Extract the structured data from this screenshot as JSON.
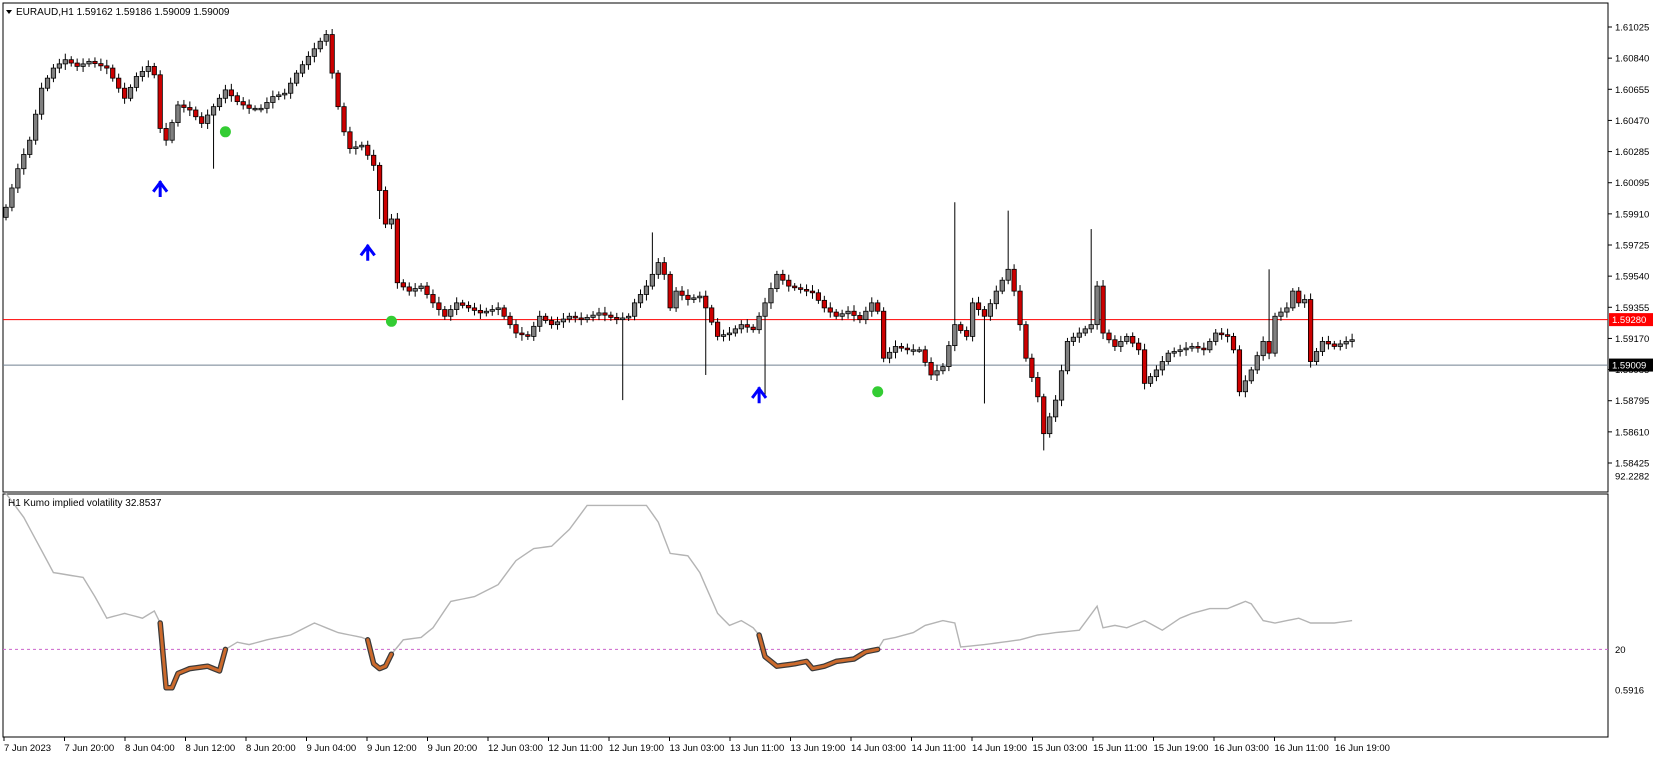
{
  "main_panel": {
    "header": "EURAUD,H1  1.59162 1.59186 1.59009 1.59009",
    "price_axis": [
      "1.61025",
      "1.60840",
      "1.60655",
      "1.60470",
      "1.60285",
      "1.60095",
      "1.59910",
      "1.59725",
      "1.59540",
      "1.59355",
      "1.59170",
      "1.58985",
      "1.58795",
      "1.58610",
      "1.58425"
    ],
    "red_line_label": "1.59280",
    "current_price_label": "1.59009",
    "colors": {
      "bull_body": "#808080",
      "bear_body": "#cc0000",
      "wick": "#000000",
      "red_line": "#ff0000",
      "price_line": "#708090",
      "arrow": "#0000ff",
      "dot": "#33cc33"
    }
  },
  "indicator_panel": {
    "header": "H1 Kumo implied volatility 32.8537",
    "axis_labels": [
      "92.2282",
      "20",
      "0.5916"
    ],
    "colors": {
      "line": "#b4b4b4",
      "highlight": "#cc6a2c",
      "level": "#cc66cc"
    }
  },
  "time_axis": [
    "7 Jun 2023",
    "7 Jun 20:00",
    "8 Jun 04:00",
    "8 Jun 12:00",
    "8 Jun 20:00",
    "9 Jun 04:00",
    "9 Jun 12:00",
    "9 Jun 20:00",
    "12 Jun 03:00",
    "12 Jun 11:00",
    "12 Jun 19:00",
    "13 Jun 03:00",
    "13 Jun 11:00",
    "13 Jun 19:00",
    "14 Jun 03:00",
    "14 Jun 11:00",
    "14 Jun 19:00",
    "15 Jun 03:00",
    "15 Jun 11:00",
    "15 Jun 19:00",
    "16 Jun 03:00",
    "16 Jun 11:00",
    "16 Jun 19:00"
  ],
  "chart_data": {
    "type": "candlestick",
    "symbol": "EURAUD",
    "timeframe": "H1",
    "last_bar": {
      "open": 1.59162,
      "high": 1.59186,
      "low": 1.59009,
      "close": 1.59009
    },
    "ylim": [
      1.58425,
      1.61025
    ],
    "red_level": 1.5928,
    "current_price": 1.59009,
    "anchors": [
      {
        "i": 0,
        "p": 1.5995
      },
      {
        "i": 2,
        "p": 1.6018
      },
      {
        "i": 4,
        "p": 1.6035
      },
      {
        "i": 6,
        "p": 1.6066
      },
      {
        "i": 8,
        "p": 1.6078
      },
      {
        "i": 10,
        "p": 1.6083
      },
      {
        "i": 12,
        "p": 1.6079
      },
      {
        "i": 14,
        "p": 1.6082
      },
      {
        "i": 17,
        "p": 1.6078
      },
      {
        "i": 20,
        "p": 1.606
      },
      {
        "i": 22,
        "p": 1.6073
      },
      {
        "i": 24,
        "p": 1.6079
      },
      {
        "i": 25,
        "p": 1.6074
      },
      {
        "i": 26,
        "p": 1.6042
      },
      {
        "i": 27,
        "p": 1.6035
      },
      {
        "i": 29,
        "p": 1.6056
      },
      {
        "i": 31,
        "p": 1.6053
      },
      {
        "i": 33,
        "p": 1.6045
      },
      {
        "i": 35,
        "p": 1.6055
      },
      {
        "i": 37,
        "p": 1.6065
      },
      {
        "i": 39,
        "p": 1.6058
      },
      {
        "i": 41,
        "p": 1.6054
      },
      {
        "i": 43,
        "p": 1.6054
      },
      {
        "i": 45,
        "p": 1.6061
      },
      {
        "i": 47,
        "p": 1.6063
      },
      {
        "i": 49,
        "p": 1.6075
      },
      {
        "i": 51,
        "p": 1.6085
      },
      {
        "i": 53,
        "p": 1.6094
      },
      {
        "i": 54,
        "p": 1.6098
      },
      {
        "i": 55,
        "p": 1.6075
      },
      {
        "i": 56,
        "p": 1.6055
      },
      {
        "i": 57,
        "p": 1.604
      },
      {
        "i": 58,
        "p": 1.603
      },
      {
        "i": 60,
        "p": 1.6032
      },
      {
        "i": 62,
        "p": 1.602
      },
      {
        "i": 63,
        "p": 1.6005
      },
      {
        "i": 64,
        "p": 1.5985
      },
      {
        "i": 65,
        "p": 1.5988
      },
      {
        "i": 66,
        "p": 1.595
      },
      {
        "i": 68,
        "p": 1.5945
      },
      {
        "i": 70,
        "p": 1.5948
      },
      {
        "i": 72,
        "p": 1.5938
      },
      {
        "i": 74,
        "p": 1.593
      },
      {
        "i": 76,
        "p": 1.5938
      },
      {
        "i": 78,
        "p": 1.5935
      },
      {
        "i": 80,
        "p": 1.5932
      },
      {
        "i": 83,
        "p": 1.5935
      },
      {
        "i": 86,
        "p": 1.592
      },
      {
        "i": 88,
        "p": 1.5918
      },
      {
        "i": 90,
        "p": 1.593
      },
      {
        "i": 92,
        "p": 1.5925
      },
      {
        "i": 95,
        "p": 1.593
      },
      {
        "i": 97,
        "p": 1.5928
      },
      {
        "i": 100,
        "p": 1.5932
      },
      {
        "i": 103,
        "p": 1.5928
      },
      {
        "i": 105,
        "p": 1.593
      },
      {
        "i": 106,
        "p": 1.5938
      },
      {
        "i": 108,
        "p": 1.5948
      },
      {
        "i": 110,
        "p": 1.5962
      },
      {
        "i": 111,
        "p": 1.5955
      },
      {
        "i": 112,
        "p": 1.5935
      },
      {
        "i": 113,
        "p": 1.5945
      },
      {
        "i": 115,
        "p": 1.594
      },
      {
        "i": 117,
        "p": 1.5942
      },
      {
        "i": 118,
        "p": 1.5935
      },
      {
        "i": 120,
        "p": 1.5918
      },
      {
        "i": 122,
        "p": 1.592
      },
      {
        "i": 124,
        "p": 1.5925
      },
      {
        "i": 126,
        "p": 1.5922
      },
      {
        "i": 128,
        "p": 1.5938
      },
      {
        "i": 130,
        "p": 1.5955
      },
      {
        "i": 132,
        "p": 1.5948
      },
      {
        "i": 134,
        "p": 1.5946
      },
      {
        "i": 136,
        "p": 1.5944
      },
      {
        "i": 138,
        "p": 1.5935
      },
      {
        "i": 140,
        "p": 1.593
      },
      {
        "i": 142,
        "p": 1.5933
      },
      {
        "i": 144,
        "p": 1.5928
      },
      {
        "i": 146,
        "p": 1.5938
      },
      {
        "i": 147,
        "p": 1.5933
      },
      {
        "i": 148,
        "p": 1.5905
      },
      {
        "i": 150,
        "p": 1.5912
      },
      {
        "i": 152,
        "p": 1.591
      },
      {
        "i": 154,
        "p": 1.591
      },
      {
        "i": 156,
        "p": 1.5895
      },
      {
        "i": 158,
        "p": 1.59
      },
      {
        "i": 160,
        "p": 1.5925
      },
      {
        "i": 162,
        "p": 1.5918
      },
      {
        "i": 163,
        "p": 1.5938
      },
      {
        "i": 165,
        "p": 1.593
      },
      {
        "i": 167,
        "p": 1.5945
      },
      {
        "i": 169,
        "p": 1.5958
      },
      {
        "i": 170,
        "p": 1.5945
      },
      {
        "i": 172,
        "p": 1.5905
      },
      {
        "i": 174,
        "p": 1.5882
      },
      {
        "i": 175,
        "p": 1.586
      },
      {
        "i": 177,
        "p": 1.588
      },
      {
        "i": 179,
        "p": 1.5915
      },
      {
        "i": 181,
        "p": 1.592
      },
      {
        "i": 183,
        "p": 1.5925
      },
      {
        "i": 184,
        "p": 1.5948
      },
      {
        "i": 185,
        "p": 1.592
      },
      {
        "i": 187,
        "p": 1.5912
      },
      {
        "i": 189,
        "p": 1.5918
      },
      {
        "i": 191,
        "p": 1.591
      },
      {
        "i": 192,
        "p": 1.589
      },
      {
        "i": 194,
        "p": 1.5898
      },
      {
        "i": 196,
        "p": 1.5908
      },
      {
        "i": 198,
        "p": 1.591
      },
      {
        "i": 200,
        "p": 1.5912
      },
      {
        "i": 202,
        "p": 1.591
      },
      {
        "i": 204,
        "p": 1.592
      },
      {
        "i": 206,
        "p": 1.5918
      },
      {
        "i": 207,
        "p": 1.591
      },
      {
        "i": 208,
        "p": 1.5885
      },
      {
        "i": 210,
        "p": 1.5898
      },
      {
        "i": 212,
        "p": 1.5915
      },
      {
        "i": 213,
        "p": 1.5908
      },
      {
        "i": 214,
        "p": 1.593
      },
      {
        "i": 216,
        "p": 1.5935
      },
      {
        "i": 217,
        "p": 1.5945
      },
      {
        "i": 218,
        "p": 1.5938
      },
      {
        "i": 219,
        "p": 1.594
      },
      {
        "i": 220,
        "p": 1.5903
      },
      {
        "i": 222,
        "p": 1.5915
      },
      {
        "i": 224,
        "p": 1.5912
      },
      {
        "i": 226,
        "p": 1.5915
      },
      {
        "i": 227,
        "p": 1.5916
      }
    ],
    "spikes": [
      {
        "i": 35,
        "low": 1.6018
      },
      {
        "i": 63,
        "low": 1.5988
      },
      {
        "i": 109,
        "high": 1.598
      },
      {
        "i": 118,
        "low": 1.5895
      },
      {
        "i": 104,
        "low": 1.588
      },
      {
        "i": 128,
        "low": 1.5883
      },
      {
        "i": 160,
        "high": 1.5998
      },
      {
        "i": 165,
        "low": 1.5878
      },
      {
        "i": 169,
        "high": 1.5993
      },
      {
        "i": 183,
        "high": 1.5982
      },
      {
        "i": 213,
        "high": 1.5958
      },
      {
        "i": 175,
        "low": 1.585
      }
    ],
    "buy_arrows": [
      {
        "i": 26,
        "price": 1.6008
      },
      {
        "i": 61,
        "price": 1.597
      },
      {
        "i": 127,
        "price": 1.5885
      }
    ],
    "dots": [
      {
        "i": 37,
        "price": 1.604
      },
      {
        "i": 65,
        "price": 1.5927
      },
      {
        "i": 147,
        "price": 1.5885
      }
    ],
    "indicator": {
      "name": "Kumo implied volatility",
      "value": 32.8537,
      "ylim": [
        0.5916,
        92.2282
      ],
      "level": 20,
      "line": [
        {
          "i": 0,
          "v": 85
        },
        {
          "i": 3,
          "v": 75
        },
        {
          "i": 8,
          "v": 52
        },
        {
          "i": 13,
          "v": 50
        },
        {
          "i": 15,
          "v": 42
        },
        {
          "i": 17,
          "v": 33
        },
        {
          "i": 20,
          "v": 35
        },
        {
          "i": 23,
          "v": 33
        },
        {
          "i": 25,
          "v": 36
        },
        {
          "i": 26,
          "v": 31
        },
        {
          "i": 27,
          "v": 4
        },
        {
          "i": 28,
          "v": 4
        },
        {
          "i": 29,
          "v": 10
        },
        {
          "i": 31,
          "v": 12
        },
        {
          "i": 34,
          "v": 13
        },
        {
          "i": 36,
          "v": 11
        },
        {
          "i": 37,
          "v": 20
        },
        {
          "i": 39,
          "v": 23
        },
        {
          "i": 41,
          "v": 22
        },
        {
          "i": 44,
          "v": 24
        },
        {
          "i": 48,
          "v": 26
        },
        {
          "i": 52,
          "v": 31
        },
        {
          "i": 56,
          "v": 27
        },
        {
          "i": 60,
          "v": 25
        },
        {
          "i": 61,
          "v": 24
        },
        {
          "i": 62,
          "v": 14
        },
        {
          "i": 63,
          "v": 12
        },
        {
          "i": 64,
          "v": 13
        },
        {
          "i": 65,
          "v": 18
        },
        {
          "i": 67,
          "v": 24
        },
        {
          "i": 70,
          "v": 25
        },
        {
          "i": 72,
          "v": 29
        },
        {
          "i": 75,
          "v": 40
        },
        {
          "i": 79,
          "v": 42
        },
        {
          "i": 83,
          "v": 47
        },
        {
          "i": 86,
          "v": 57
        },
        {
          "i": 89,
          "v": 62
        },
        {
          "i": 92,
          "v": 63
        },
        {
          "i": 95,
          "v": 70
        },
        {
          "i": 98,
          "v": 80
        },
        {
          "i": 101,
          "v": 80
        },
        {
          "i": 105,
          "v": 80
        },
        {
          "i": 108,
          "v": 80
        },
        {
          "i": 110,
          "v": 73
        },
        {
          "i": 112,
          "v": 60
        },
        {
          "i": 115,
          "v": 59
        },
        {
          "i": 117,
          "v": 52
        },
        {
          "i": 120,
          "v": 35
        },
        {
          "i": 122,
          "v": 30
        },
        {
          "i": 124,
          "v": 32
        },
        {
          "i": 126,
          "v": 29
        },
        {
          "i": 127,
          "v": 26
        },
        {
          "i": 128,
          "v": 17
        },
        {
          "i": 130,
          "v": 13
        },
        {
          "i": 133,
          "v": 14
        },
        {
          "i": 135,
          "v": 15
        },
        {
          "i": 136,
          "v": 12
        },
        {
          "i": 138,
          "v": 13
        },
        {
          "i": 140,
          "v": 15
        },
        {
          "i": 143,
          "v": 16
        },
        {
          "i": 145,
          "v": 19
        },
        {
          "i": 147,
          "v": 20
        },
        {
          "i": 148,
          "v": 24
        },
        {
          "i": 150,
          "v": 25
        },
        {
          "i": 153,
          "v": 27
        },
        {
          "i": 155,
          "v": 30
        },
        {
          "i": 158,
          "v": 32
        },
        {
          "i": 160,
          "v": 31
        },
        {
          "i": 161,
          "v": 21
        },
        {
          "i": 165,
          "v": 22
        },
        {
          "i": 168,
          "v": 23
        },
        {
          "i": 171,
          "v": 24
        },
        {
          "i": 174,
          "v": 26
        },
        {
          "i": 177,
          "v": 27
        },
        {
          "i": 181,
          "v": 28
        },
        {
          "i": 184,
          "v": 38
        },
        {
          "i": 185,
          "v": 29
        },
        {
          "i": 187,
          "v": 30
        },
        {
          "i": 189,
          "v": 29
        },
        {
          "i": 192,
          "v": 32
        },
        {
          "i": 195,
          "v": 28
        },
        {
          "i": 198,
          "v": 33
        },
        {
          "i": 200,
          "v": 35
        },
        {
          "i": 203,
          "v": 37
        },
        {
          "i": 206,
          "v": 37
        },
        {
          "i": 209,
          "v": 40
        },
        {
          "i": 210,
          "v": 39
        },
        {
          "i": 212,
          "v": 32
        },
        {
          "i": 214,
          "v": 31
        },
        {
          "i": 216,
          "v": 32
        },
        {
          "i": 218,
          "v": 33
        },
        {
          "i": 220,
          "v": 31
        },
        {
          "i": 224,
          "v": 31
        },
        {
          "i": 227,
          "v": 32
        }
      ],
      "highlights": [
        [
          26,
          37
        ],
        [
          61,
          65
        ],
        [
          127,
          147
        ]
      ]
    }
  }
}
